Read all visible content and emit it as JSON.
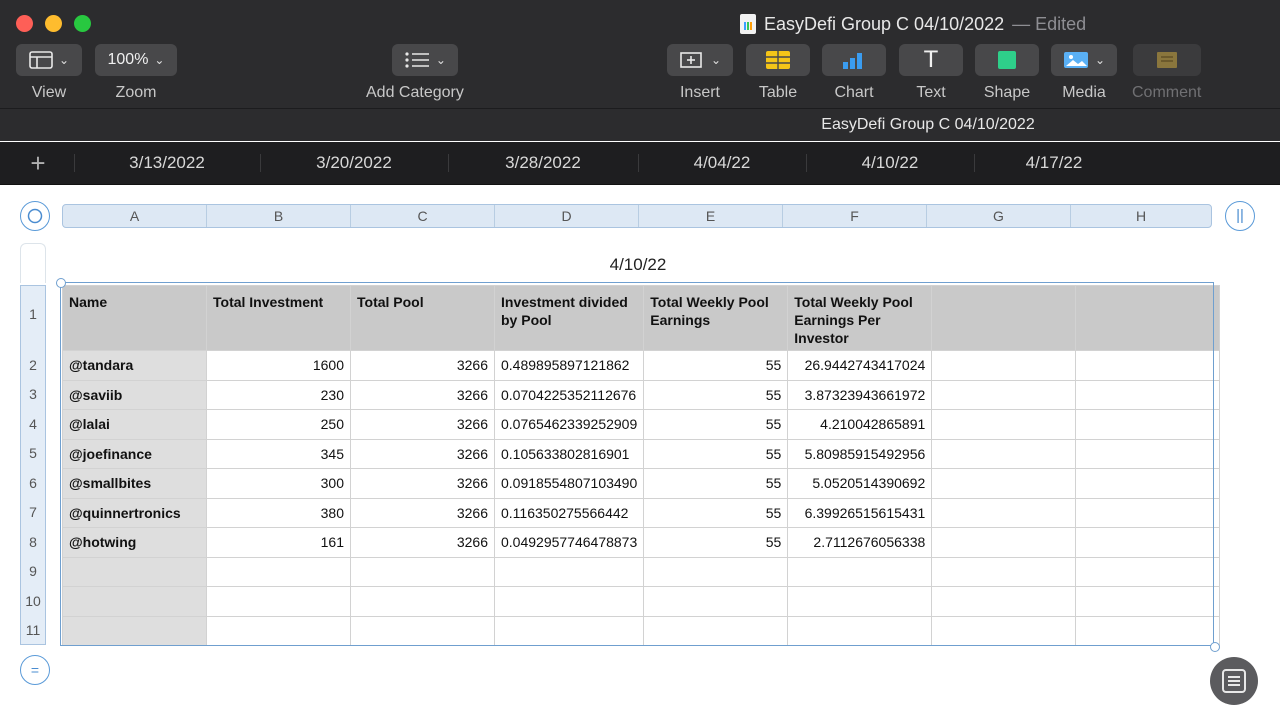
{
  "window": {
    "title": "EasyDefi Group C 04/10/2022",
    "status": "— Edited"
  },
  "toolbar": {
    "view": {
      "label": "View",
      "icon": "sidebar-icon"
    },
    "zoom": {
      "label": "Zoom",
      "value": "100%"
    },
    "add_category": {
      "label": "Add Category",
      "icon": "list-icon"
    },
    "insert": {
      "label": "Insert",
      "icon": "insert-icon"
    },
    "table": {
      "label": "Table",
      "icon": "table-icon",
      "color": "#f5c518"
    },
    "chart": {
      "label": "Chart",
      "icon": "chart-icon",
      "color": "#3a9cf0"
    },
    "text": {
      "label": "Text",
      "glyph": "T"
    },
    "shape": {
      "label": "Shape",
      "icon": "shape-icon",
      "color": "#2ecf8a"
    },
    "media": {
      "label": "Media",
      "icon": "media-icon",
      "color": "#5ab0f5"
    },
    "comment": {
      "label": "Comment",
      "icon": "comment-icon",
      "color": "#d8b44a"
    }
  },
  "sheet_title": "EasyDefi Group C 04/10/2022",
  "sheet_tabs": [
    "3/13/2022",
    "3/20/2022",
    "3/28/2022",
    "4/04/22",
    "4/10/22",
    "4/17/22"
  ],
  "column_letters": [
    "A",
    "B",
    "C",
    "D",
    "E",
    "F",
    "G",
    "H"
  ],
  "row_numbers": [
    "1",
    "2",
    "3",
    "4",
    "5",
    "6",
    "7",
    "8",
    "9",
    "10",
    "11"
  ],
  "table": {
    "title": "4/10/22",
    "headers": [
      "Name",
      "Total Investment",
      "Total Pool",
      "Investment divided by Pool",
      "Total Weekly Pool Earnings",
      "Total Weekly Pool Earnings Per Investor",
      "",
      ""
    ],
    "rows": [
      [
        "@tandara",
        "1600",
        "3266",
        "0.489895897121862",
        "55",
        "26.9442743417024",
        "",
        ""
      ],
      [
        "@saviib",
        "230",
        "3266",
        "0.0704225352112676",
        "55",
        "3.87323943661972",
        "",
        ""
      ],
      [
        "@lalai",
        "250",
        "3266",
        "0.0765462339252909",
        "55",
        "4.210042865891",
        "",
        ""
      ],
      [
        "@joefinance",
        "345",
        "3266",
        "0.105633802816901",
        "55",
        "5.80985915492956",
        "",
        ""
      ],
      [
        "@smallbites",
        "300",
        "3266",
        "0.0918554807103490",
        "55",
        "5.0520514390692",
        "",
        ""
      ],
      [
        "@quinnertronics",
        "380",
        "3266",
        "0.116350275566442",
        "55",
        "6.39926515615431",
        "",
        ""
      ],
      [
        "@hotwing",
        "161",
        "3266",
        "0.0492957746478873",
        "55",
        "2.7112676056338",
        "",
        ""
      ],
      [
        "",
        "",
        "",
        "",
        "",
        "",
        "",
        ""
      ],
      [
        "",
        "",
        "",
        "",
        "",
        "",
        "",
        ""
      ],
      [
        "",
        "",
        "",
        "",
        "",
        "",
        "",
        ""
      ]
    ]
  }
}
